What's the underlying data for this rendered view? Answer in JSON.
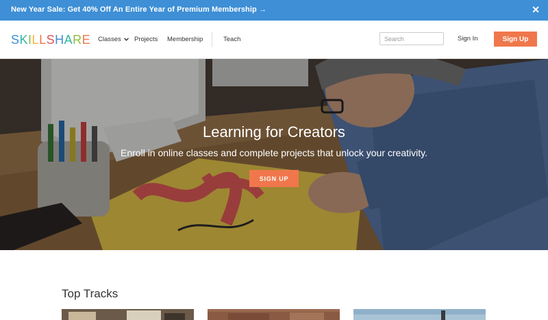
{
  "promo": {
    "text": "New Year Sale: Get 40% Off An Entire Year of Premium Membership →",
    "close": "✕"
  },
  "nav": {
    "logo_letters": [
      {
        "ch": "S",
        "color": "#3e8fd6"
      },
      {
        "ch": "K",
        "color": "#2fb5a6"
      },
      {
        "ch": "I",
        "color": "#8dbf3f"
      },
      {
        "ch": "L",
        "color": "#f0b53e"
      },
      {
        "ch": "L",
        "color": "#f0774b"
      },
      {
        "ch": "S",
        "color": "#e0565b"
      },
      {
        "ch": "H",
        "color": "#3e8fd6"
      },
      {
        "ch": "A",
        "color": "#2fb5a6"
      },
      {
        "ch": "R",
        "color": "#8dbf3f"
      },
      {
        "ch": "E",
        "color": "#f0774b"
      }
    ],
    "classes": "Classes",
    "projects": "Projects",
    "membership": "Membership",
    "teach": "Teach",
    "search_placeholder": "Search",
    "signin": "Sign In",
    "signup": "Sign Up"
  },
  "hero": {
    "title": "Learning for Creators",
    "subtitle": "Enroll in online classes and complete projects that unlock your creativity.",
    "cta": "SIGN UP"
  },
  "tracks": {
    "title": "Top Tracks"
  },
  "colors": {
    "accent": "#f0774b",
    "promo_bg": "#3e8fd6"
  }
}
